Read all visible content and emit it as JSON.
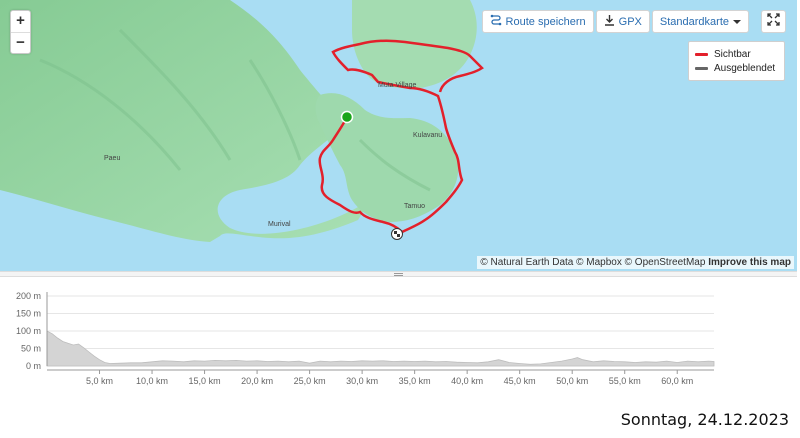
{
  "map": {
    "zoom_in_label": "+",
    "zoom_out_label": "−",
    "places": {
      "paeu": "Paeu",
      "murival": "Murival",
      "kulavanu": "Kulavanu",
      "tamuo": "Tamuo",
      "village": "Muta Village"
    },
    "attribution": {
      "text": "© Natural Earth Data © Mapbox © OpenStreetMap",
      "improve": "Improve this map"
    }
  },
  "toolbar": {
    "save_route_label": "Route speichern",
    "gpx_label": "GPX",
    "map_style_label": "Standardkarte"
  },
  "legend": {
    "items": [
      {
        "label": "Sichtbar",
        "color": "#e3202b"
      },
      {
        "label": "Ausgeblendet",
        "color": "#666666"
      }
    ]
  },
  "colors": {
    "water": "#a9ddf3",
    "land": "#9ed9ad",
    "route": "#e3202b",
    "start": "#1aa51a",
    "profile_fill": "#d4d4d4"
  },
  "elevation": {
    "y_ticks": [
      "200 m",
      "150 m",
      "100 m",
      "50 m",
      "0 m"
    ],
    "y_values": [
      200,
      150,
      100,
      50,
      0
    ],
    "x_ticks": [
      "5,0 km",
      "10,0 km",
      "15,0 km",
      "20,0 km",
      "25,0 km",
      "30,0 km",
      "35,0 km",
      "40,0 km",
      "45,0 km",
      "50,0 km",
      "55,0 km",
      "60,0 km"
    ],
    "x_values": [
      5,
      10,
      15,
      20,
      25,
      30,
      35,
      40,
      45,
      50,
      55,
      60
    ],
    "max_km": 63.5,
    "profile": [
      [
        0,
        100
      ],
      [
        0.5,
        92
      ],
      [
        1,
        80
      ],
      [
        1.5,
        70
      ],
      [
        2,
        65
      ],
      [
        2.5,
        60
      ],
      [
        3,
        63
      ],
      [
        3.5,
        52
      ],
      [
        4,
        40
      ],
      [
        4.5,
        28
      ],
      [
        5,
        18
      ],
      [
        5.5,
        10
      ],
      [
        6,
        7
      ],
      [
        7,
        8
      ],
      [
        8,
        9
      ],
      [
        9,
        9
      ],
      [
        10,
        12
      ],
      [
        11,
        15
      ],
      [
        12,
        14
      ],
      [
        13,
        12
      ],
      [
        14,
        15
      ],
      [
        15,
        14
      ],
      [
        16,
        16
      ],
      [
        17,
        15
      ],
      [
        18,
        16
      ],
      [
        19,
        14
      ],
      [
        20,
        15
      ],
      [
        21,
        13
      ],
      [
        22,
        14
      ],
      [
        23,
        12
      ],
      [
        24,
        14
      ],
      [
        25,
        8
      ],
      [
        26,
        14
      ],
      [
        27,
        12
      ],
      [
        28,
        14
      ],
      [
        29,
        13
      ],
      [
        30,
        15
      ],
      [
        31,
        14
      ],
      [
        32,
        15
      ],
      [
        33,
        13
      ],
      [
        34,
        14
      ],
      [
        35,
        13
      ],
      [
        36,
        14
      ],
      [
        37,
        12
      ],
      [
        38,
        13
      ],
      [
        39,
        11
      ],
      [
        40,
        10
      ],
      [
        41,
        9
      ],
      [
        42,
        12
      ],
      [
        43,
        18
      ],
      [
        44,
        10
      ],
      [
        45,
        7
      ],
      [
        46,
        5
      ],
      [
        47,
        6
      ],
      [
        48,
        10
      ],
      [
        49,
        14
      ],
      [
        50,
        20
      ],
      [
        50.5,
        24
      ],
      [
        51,
        18
      ],
      [
        52,
        12
      ],
      [
        53,
        15
      ],
      [
        54,
        13
      ],
      [
        55,
        12
      ],
      [
        56,
        10
      ],
      [
        57,
        12
      ],
      [
        58,
        11
      ],
      [
        59,
        14
      ],
      [
        60,
        10
      ],
      [
        61,
        14
      ],
      [
        62,
        12
      ],
      [
        63,
        14
      ],
      [
        63.5,
        13
      ]
    ]
  },
  "footer": {
    "date": "Sonntag, 24.12.2023"
  }
}
